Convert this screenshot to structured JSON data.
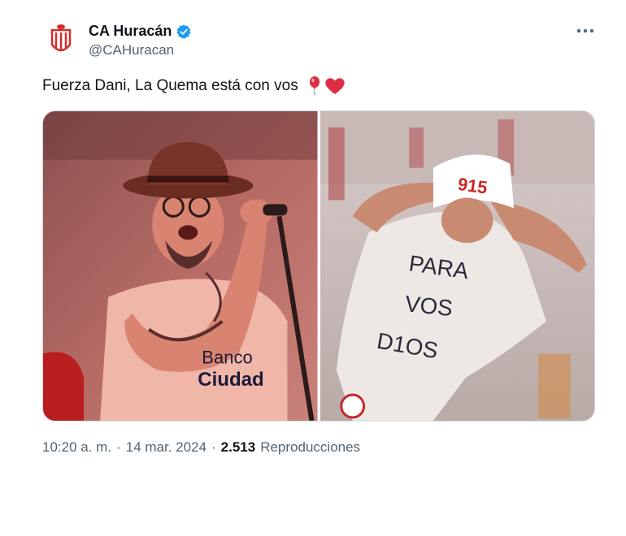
{
  "account": {
    "name": "CA Huracán",
    "handle": "@CAHuracan",
    "verified_color": "#1d9bf0",
    "brand_color": "#d62b2b"
  },
  "tweet": {
    "text": "Fuerza Dani, La Quema está con vos",
    "emojis": [
      "balloon-icon",
      "red-heart-icon"
    ]
  },
  "media": {
    "left_shirt_words": [
      "Banco",
      "Ciudad"
    ],
    "right_shirt_words": [
      "PARA",
      "VOS",
      "D1OS"
    ]
  },
  "meta": {
    "time": "10:20 a. m.",
    "separator": "·",
    "date": "14 mar. 2024",
    "views_count": "2.513",
    "views_label": "Reproducciones"
  }
}
